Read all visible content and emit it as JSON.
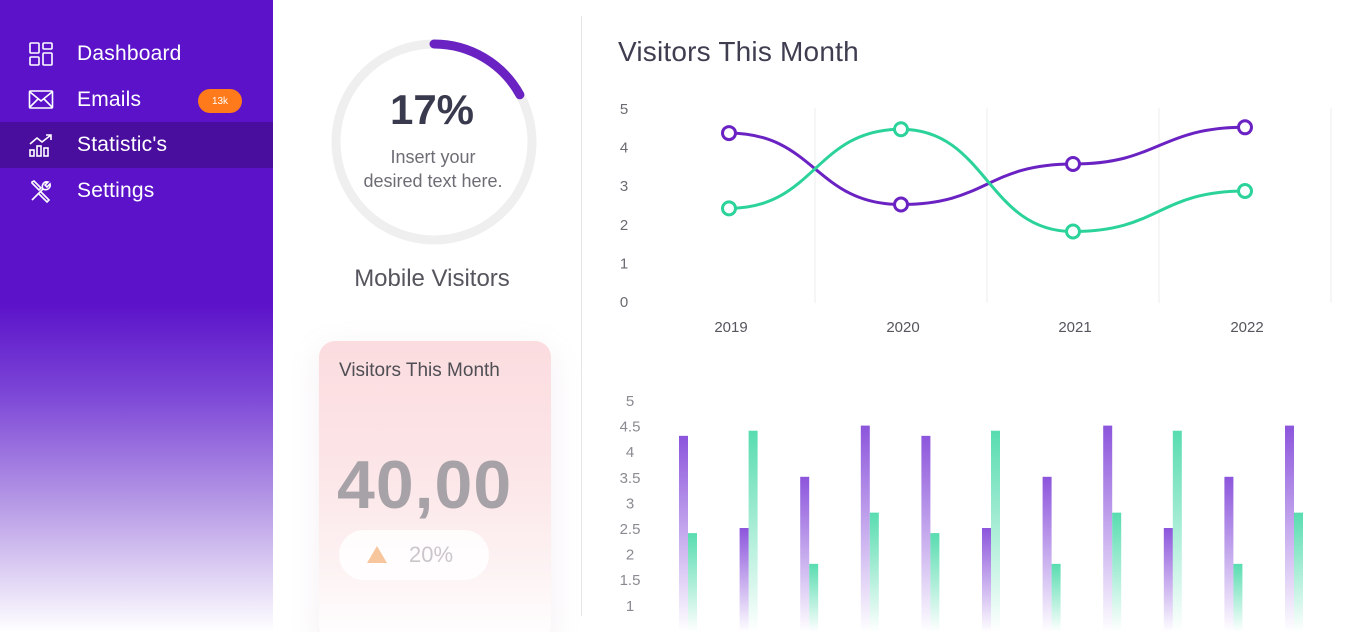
{
  "sidebar": {
    "items": [
      {
        "label": "Dashboard",
        "icon": "dashboard-icon"
      },
      {
        "label": "Emails",
        "icon": "mail-icon",
        "badge": "13k"
      },
      {
        "label": "Statistic's",
        "icon": "statistics-icon",
        "active": true
      },
      {
        "label": "Settings",
        "icon": "tools-icon"
      }
    ]
  },
  "gauge": {
    "value": "17%",
    "progress": 0.17,
    "text": "Insert your desired text here.",
    "label": "Mobile Visitors"
  },
  "visitor_card": {
    "title": "Visitors This Month",
    "value": "40,00",
    "change": "20%"
  },
  "colors": {
    "primary": "#5b12c9",
    "sidebar_active": "#4a0e9e",
    "purple_series": "#6a22c2",
    "green_series": "#2bd39b",
    "badge": "#ff7a1a"
  },
  "chart_data": [
    {
      "type": "line",
      "title": "Visitors This Month",
      "categories": [
        "2019",
        "2020",
        "2021",
        "2022"
      ],
      "ylim": [
        0,
        5
      ],
      "yticks": [
        "0",
        "1",
        "2",
        "3",
        "4",
        "5"
      ],
      "grid": "vertical",
      "series": [
        {
          "color": "#6a22c2",
          "values": [
            4.35,
            2.5,
            3.55,
            4.5
          ]
        },
        {
          "color": "#2bd39b",
          "values": [
            2.4,
            4.45,
            1.8,
            2.85
          ]
        }
      ]
    },
    {
      "type": "bar",
      "ylim": [
        0,
        5
      ],
      "yticks": [
        "1",
        "1.5",
        "2",
        "2.5",
        "3",
        "3.5",
        "4",
        "4.5",
        "5"
      ],
      "series": [
        {
          "color": "#8c55dc",
          "values": [
            4.3,
            2.5,
            3.5,
            4.5,
            4.3,
            2.5,
            3.5,
            4.5,
            2.5,
            3.5,
            4.5
          ]
        },
        {
          "color": "#58dcb0",
          "values": [
            2.4,
            4.4,
            1.8,
            2.8,
            2.4,
            4.4,
            1.8,
            2.8,
            4.4,
            1.8,
            2.8
          ]
        }
      ]
    }
  ]
}
